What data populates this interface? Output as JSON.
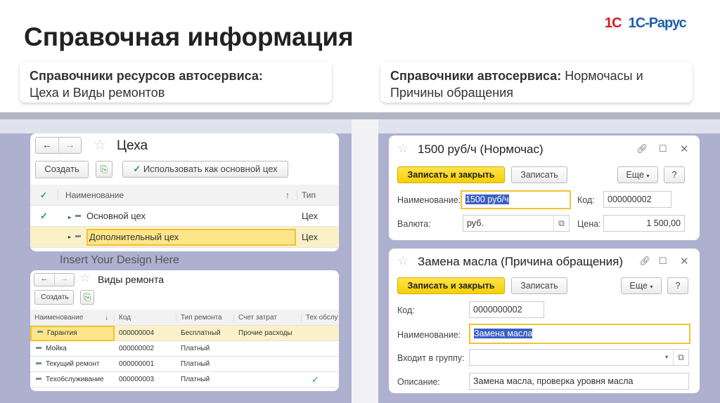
{
  "slide": {
    "title": "Справочная информация",
    "logo_1c": "1С",
    "logo_rarus": "1С-Рарус",
    "bg_text": "Insert Your Design Here",
    "left_card": {
      "bold": "Справочники ресурсов автосервиса:",
      "text": "Цеха и Виды ремонтов"
    },
    "right_card": {
      "bold": "Справочники автосервиса:",
      "text_inline": " Нормочасы и",
      "text": "Причины обращения"
    }
  },
  "tsekha": {
    "title": "Цеха",
    "create": "Создать",
    "use_main": "Использовать как основной цех",
    "columns": [
      "Наименование",
      "Тип"
    ],
    "sort_icon": "↑",
    "rows": [
      {
        "name": "Основной цех",
        "type": "Цех",
        "main": true
      },
      {
        "name": "Дополнительный цех",
        "type": "Цех",
        "main": false,
        "selected": true
      }
    ]
  },
  "vidy": {
    "title": "Виды ремонта",
    "create": "Создать",
    "columns": [
      "Наименование",
      "Код",
      "Тип ремонта",
      "Счет затрат",
      "Тех обслу"
    ],
    "sort_icon": "↓",
    "rows": [
      [
        "Гарантия",
        "000000004",
        "Бесплатный",
        "Прочие расходы",
        ""
      ],
      [
        "Мойка",
        "000000002",
        "Платный",
        "",
        ""
      ],
      [
        "Текущий ремонт",
        "000000001",
        "Платный",
        "",
        ""
      ],
      [
        "Техобслуживание",
        "000000003",
        "Платный",
        "",
        "✓"
      ]
    ]
  },
  "normochas": {
    "title": "1500 руб/ч (Нормочас)",
    "save_close": "Записать и закрыть",
    "save": "Записать",
    "more": "Еще",
    "help": "?",
    "name_label": "Наименование:",
    "name_value": "1500 руб/ч",
    "code_label": "Код:",
    "code_value": "000000002",
    "currency_label": "Валюта:",
    "currency_value": "руб.",
    "price_label": "Цена:",
    "price_value": "1 500,00"
  },
  "prichina": {
    "title": "Замена масла (Причина обращения)",
    "save_close": "Записать и закрыть",
    "save": "Записать",
    "more": "Еще",
    "help": "?",
    "code_label": "Код:",
    "code_value": "0000000002",
    "name_label": "Наименование:",
    "name_value": "Замена масла",
    "group_label": "Входит в группу:",
    "group_value": "",
    "desc_label": "Описание:",
    "desc_value": "Замена масла, проверка уровня масла"
  },
  "colors": {
    "accent_yellow": "#f7cf00",
    "panel": "#aeb0d0",
    "check": "#1aa34a"
  }
}
